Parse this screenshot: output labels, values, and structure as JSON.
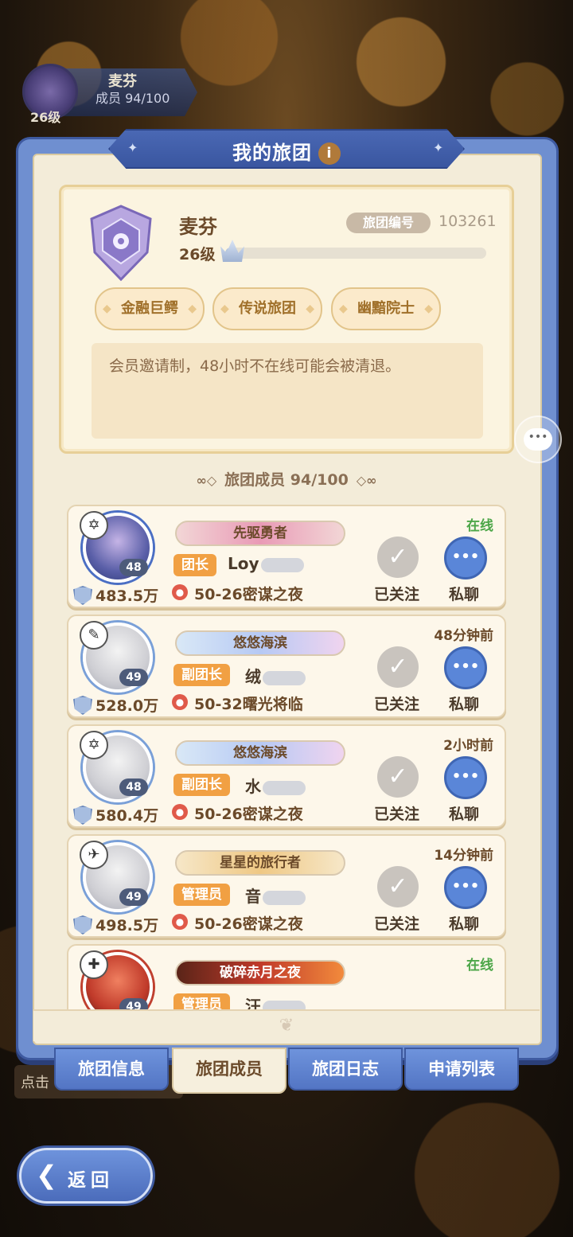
{
  "top_badge": {
    "name": "麦芬",
    "members": "成员 94/100",
    "level": "26级"
  },
  "panel": {
    "title": "我的旅团"
  },
  "guild": {
    "name": "麦芬",
    "id_label": "旅团编号",
    "id": "103261",
    "level": "26级",
    "xp_fraction": 0.05,
    "tags": [
      "金融巨鳄",
      "传说旅团",
      "幽黯院士"
    ],
    "notice": "会员邀请制，48小时不在线可能会被清退。"
  },
  "members_header": {
    "label": "旅团成员 94/100"
  },
  "members": [
    {
      "status": "在线",
      "title": "先驱勇者",
      "role": "团长",
      "name": "Loy",
      "level": "48",
      "power": "483.5万",
      "server": "50-26密谋之夜",
      "follow": "已关注",
      "chat": "私聊"
    },
    {
      "status": "48分钟前",
      "title": "悠悠海滨",
      "role": "副团长",
      "name": "绒",
      "level": "49",
      "power": "528.0万",
      "server": "50-32曙光将临",
      "follow": "已关注",
      "chat": "私聊"
    },
    {
      "status": "2小时前",
      "title": "悠悠海滨",
      "role": "副团长",
      "name": "水",
      "level": "48",
      "power": "580.4万",
      "server": "50-26密谋之夜",
      "follow": "已关注",
      "chat": "私聊"
    },
    {
      "status": "14分钟前",
      "title": "星星的旅行者",
      "role": "管理员",
      "name": "音",
      "level": "49",
      "power": "498.5万",
      "server": "50-26密谋之夜",
      "follow": "已关注",
      "chat": "私聊"
    },
    {
      "status": "在线",
      "title": "破碎赤月之夜",
      "role": "管理员",
      "name": "汪",
      "level": "49",
      "power": "",
      "server": "",
      "follow": "",
      "chat": ""
    }
  ],
  "tabs": [
    "旅团信息",
    "旅团成员",
    "旅团日志",
    "申请列表"
  ],
  "tap_hint": "点击",
  "back": {
    "label": "返回"
  },
  "colors": {
    "panel_blue": "#6f8fd0",
    "online_green": "#4ca648",
    "role_orange": "#f1a043",
    "chat_blue": "#5a86d8"
  }
}
